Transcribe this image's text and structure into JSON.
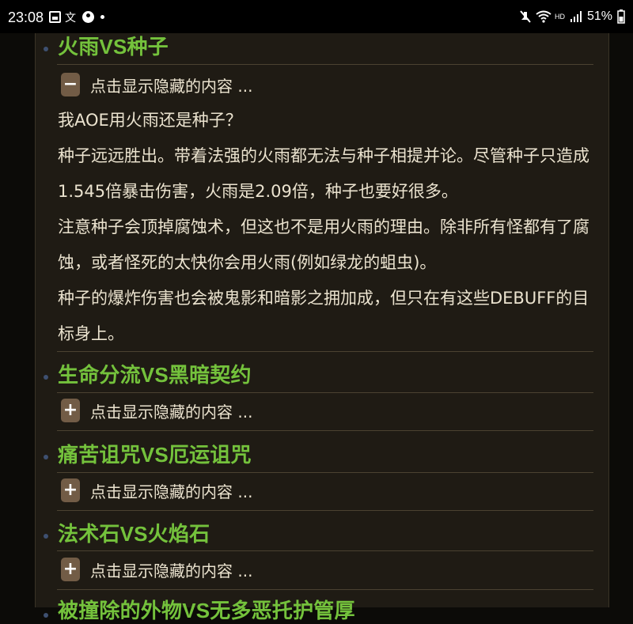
{
  "status_bar": {
    "time": "23:08",
    "translate_glyph": "文",
    "network_label": "HD",
    "battery": "51%",
    "icons": [
      "photo-icon",
      "translate-icon",
      "account-icon",
      "mute-icon",
      "wifi-icon",
      "signal-icon",
      "battery-icon"
    ]
  },
  "sections": [
    {
      "title": "火雨VS种子",
      "toggle_symbol": "−",
      "toggle_label": "点击显示隐藏的内容 ...",
      "expanded": true,
      "paragraphs": [
        "我AOE用火雨还是种子？",
        "种子远远胜出。带着法强的火雨都无法与种子相提并论。尽管种子只造成1.545倍暴击伤害，火雨是2.09倍，种子也要好很多。",
        "注意种子会顶掉腐蚀术，但这也不是用火雨的理由。除非所有怪都有了腐蚀，或者怪死的太快你会用火雨(例如绿龙的蛆虫)。",
        "种子的爆炸伤害也会被鬼影和暗影之拥加成，但只在有这些DEBUFF的目标身上。"
      ]
    },
    {
      "title": "生命分流VS黑暗契约",
      "toggle_symbol": "+",
      "toggle_label": "点击显示隐藏的内容 ...",
      "expanded": false
    },
    {
      "title": "痛苦诅咒VS厄运诅咒",
      "toggle_symbol": "+",
      "toggle_label": "点击显示隐藏的内容 ...",
      "expanded": false
    },
    {
      "title": "法术石VS火焰石",
      "toggle_symbol": "+",
      "toggle_label": "点击显示隐藏的内容 ...",
      "expanded": false
    },
    {
      "title": "被撞除的外物VS无多恶托护管厚"
    }
  ],
  "colors": {
    "heading": "#74c23c",
    "body_text": "#ebe3cf",
    "panel_bg": "#1f1b14",
    "toggle_bg": "#725c46"
  }
}
